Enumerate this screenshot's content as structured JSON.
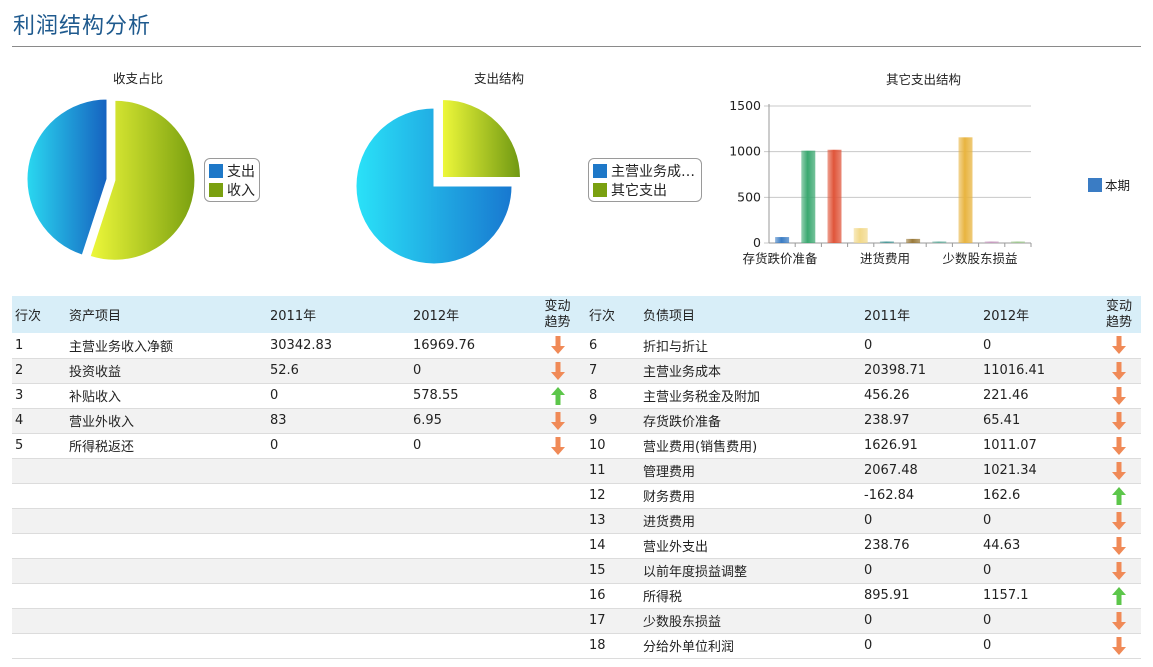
{
  "page": {
    "title": "利润结构分析"
  },
  "colors": {
    "expense_blue": "#1e88d8",
    "income_green": "#9ac21a",
    "header_bg": "#d8eef8",
    "title_blue": "#1f5a8e",
    "arrow_down": "#f08a57",
    "arrow_up": "#5cc64a"
  },
  "charts": {
    "income_expense": {
      "title": "收支占比",
      "legend": [
        "支出",
        "收入"
      ]
    },
    "expense_structure": {
      "title": "支出结构",
      "legend": [
        "主营业务成…",
        "其它支出"
      ]
    },
    "other_expense": {
      "title": "其它支出结构",
      "legend": [
        "本期"
      ],
      "y_ticks": [
        "1500",
        "1000",
        "500",
        "0"
      ],
      "x_labels": [
        "存货跌价准备",
        "进货费用",
        "少数股东损益"
      ]
    }
  },
  "chart_data": [
    {
      "type": "pie",
      "title": "收支占比",
      "labels": [
        "支出",
        "收入"
      ],
      "values": [
        45,
        55
      ]
    },
    {
      "type": "pie",
      "title": "支出结构",
      "labels": [
        "主营业务成…",
        "其它支出"
      ],
      "values": [
        75,
        25
      ]
    },
    {
      "type": "bar",
      "title": "其它支出结构",
      "series": [
        {
          "name": "本期",
          "values": [
            65,
            1011,
            1021,
            163,
            0,
            45,
            0,
            1157,
            0,
            0
          ]
        }
      ],
      "categories": [
        "",
        "",
        "",
        "",
        "",
        "",
        "",
        "",
        "",
        ""
      ],
      "x_tick_labels": [
        "存货跌价准备",
        "进货费用",
        "少数股东损益"
      ],
      "ylim": [
        0,
        1500
      ],
      "colors": [
        "#3a7cc4",
        "#3aa870",
        "#e0553a",
        "#f2d98a",
        "#4a9a9a",
        "#9a7a3a",
        "#6ab0a0",
        "#e8b440",
        "#c79ac0",
        "#a0c890"
      ]
    }
  ],
  "table_left": {
    "headers": {
      "row": "行次",
      "item": "资产项目",
      "y2011": "2011年",
      "y2012": "2012年",
      "trend1": "变动",
      "trend2": "趋势"
    },
    "rows": [
      {
        "row": "1",
        "item": "主营业务收入净额",
        "y2011": "30342.83",
        "y2012": "16969.76",
        "trend": "down"
      },
      {
        "row": "2",
        "item": "投资收益",
        "y2011": "52.6",
        "y2012": "0",
        "trend": "down"
      },
      {
        "row": "3",
        "item": "补贴收入",
        "y2011": "0",
        "y2012": "578.55",
        "trend": "up"
      },
      {
        "row": "4",
        "item": "营业外收入",
        "y2011": "83",
        "y2012": "6.95",
        "trend": "down"
      },
      {
        "row": "5",
        "item": "所得税返还",
        "y2011": "0",
        "y2012": "0",
        "trend": "down"
      }
    ]
  },
  "table_right": {
    "headers": {
      "row": "行次",
      "item": "负债项目",
      "y2011": "2011年",
      "y2012": "2012年",
      "trend1": "变动",
      "trend2": "趋势"
    },
    "rows": [
      {
        "row": "6",
        "item": "折扣与折让",
        "y2011": "0",
        "y2012": "0",
        "trend": "down"
      },
      {
        "row": "7",
        "item": "主营业务成本",
        "y2011": "20398.71",
        "y2012": "11016.41",
        "trend": "down"
      },
      {
        "row": "8",
        "item": "主营业务税金及附加",
        "y2011": "456.26",
        "y2012": "221.46",
        "trend": "down"
      },
      {
        "row": "9",
        "item": "存货跌价准备",
        "y2011": "238.97",
        "y2012": "65.41",
        "trend": "down"
      },
      {
        "row": "10",
        "item": "营业费用(销售费用)",
        "y2011": "1626.91",
        "y2012": "1011.07",
        "trend": "down"
      },
      {
        "row": "11",
        "item": "管理费用",
        "y2011": "2067.48",
        "y2012": "1021.34",
        "trend": "down"
      },
      {
        "row": "12",
        "item": "财务费用",
        "y2011": "-162.84",
        "y2012": "162.6",
        "trend": "up"
      },
      {
        "row": "13",
        "item": "进货费用",
        "y2011": "0",
        "y2012": "0",
        "trend": "down"
      },
      {
        "row": "14",
        "item": "营业外支出",
        "y2011": "238.76",
        "y2012": "44.63",
        "trend": "down"
      },
      {
        "row": "15",
        "item": "以前年度损益调整",
        "y2011": "0",
        "y2012": "0",
        "trend": "down"
      },
      {
        "row": "16",
        "item": "所得税",
        "y2011": "895.91",
        "y2012": "1157.1",
        "trend": "up"
      },
      {
        "row": "17",
        "item": "少数股东损益",
        "y2011": "0",
        "y2012": "0",
        "trend": "down"
      },
      {
        "row": "18",
        "item": "分给外单位利润",
        "y2011": "0",
        "y2012": "0",
        "trend": "down"
      }
    ]
  }
}
